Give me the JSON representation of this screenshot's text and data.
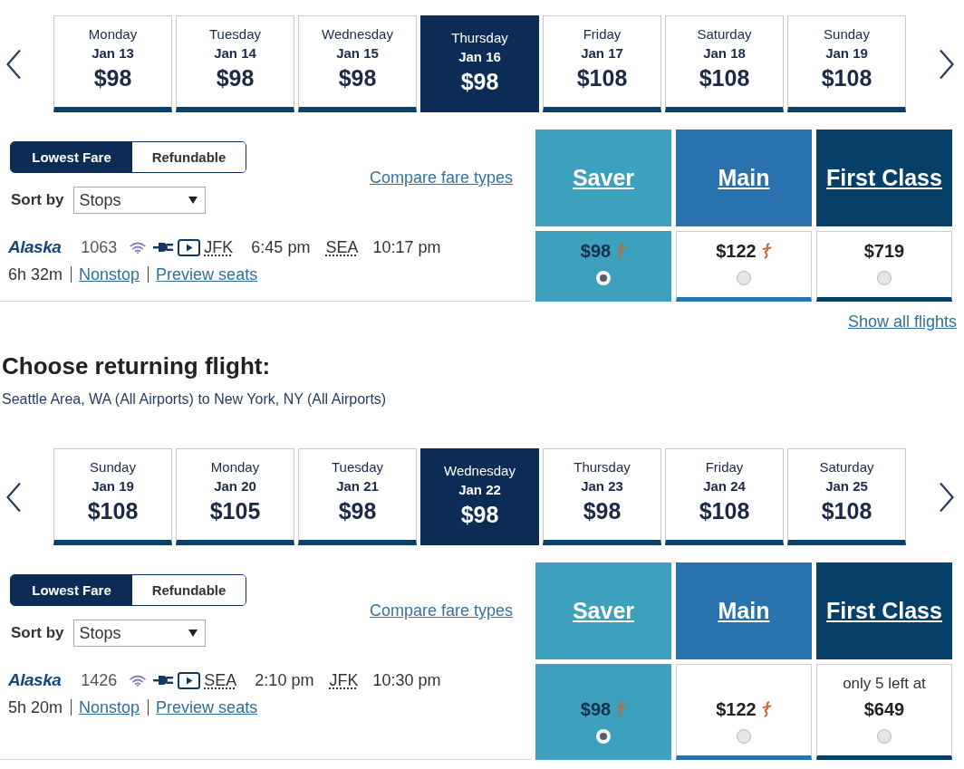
{
  "departing": {
    "dates": [
      {
        "weekday": "Monday",
        "date": "Jan 13",
        "price": "$98",
        "selected": false
      },
      {
        "weekday": "Tuesday",
        "date": "Jan 14",
        "price": "$98",
        "selected": false
      },
      {
        "weekday": "Wednesday",
        "date": "Jan 15",
        "price": "$98",
        "selected": false
      },
      {
        "weekday": "Thursday",
        "date": "Jan 16",
        "price": "$98",
        "selected": true
      },
      {
        "weekday": "Friday",
        "date": "Jan 17",
        "price": "$108",
        "selected": false
      },
      {
        "weekday": "Saturday",
        "date": "Jan 18",
        "price": "$108",
        "selected": false
      },
      {
        "weekday": "Sunday",
        "date": "Jan 19",
        "price": "$108",
        "selected": false
      }
    ],
    "fare_filter": [
      {
        "label": "Lowest Fare",
        "selected": true
      },
      {
        "label": "Refundable",
        "selected": false
      }
    ],
    "sort": {
      "label": "Sort by",
      "value": "Stops"
    },
    "compare_link": "Compare fare types",
    "fare_columns": [
      {
        "name": "Saver",
        "color": "#3da0bd"
      },
      {
        "name": "Main",
        "color": "#2a72ad"
      },
      {
        "name": "First Class",
        "color": "#063f68"
      }
    ],
    "flights": [
      {
        "airline": "Alaska",
        "number": "1063",
        "origin": "JFK",
        "departs": "6:45 pm",
        "destination": "SEA",
        "arrives": "10:17 pm",
        "duration": "6h 32m",
        "stops_link": "Nonstop",
        "seats_link": "Preview seats",
        "fares": [
          {
            "price": "$98",
            "fare_icon": true,
            "selected": true
          },
          {
            "price": "$122",
            "fare_icon": true,
            "selected": false
          },
          {
            "price": "$719",
            "fare_icon": false,
            "selected": false
          }
        ]
      }
    ],
    "show_all_link": "Show all flights"
  },
  "returning": {
    "heading": "Choose returning flight:",
    "route": "Seattle Area, WA (All Airports) to New York, NY (All Airports)",
    "dates": [
      {
        "weekday": "Sunday",
        "date": "Jan 19",
        "price": "$108",
        "selected": false
      },
      {
        "weekday": "Monday",
        "date": "Jan 20",
        "price": "$105",
        "selected": false
      },
      {
        "weekday": "Tuesday",
        "date": "Jan 21",
        "price": "$98",
        "selected": false
      },
      {
        "weekday": "Wednesday",
        "date": "Jan 22",
        "price": "$98",
        "selected": true
      },
      {
        "weekday": "Thursday",
        "date": "Jan 23",
        "price": "$98",
        "selected": false
      },
      {
        "weekday": "Friday",
        "date": "Jan 24",
        "price": "$108",
        "selected": false
      },
      {
        "weekday": "Saturday",
        "date": "Jan 25",
        "price": "$108",
        "selected": false
      }
    ],
    "fare_filter": [
      {
        "label": "Lowest Fare",
        "selected": true
      },
      {
        "label": "Refundable",
        "selected": false
      }
    ],
    "sort": {
      "label": "Sort by",
      "value": "Stops"
    },
    "compare_link": "Compare fare types",
    "fare_columns": [
      {
        "name": "Saver",
        "color": "#3da0bd"
      },
      {
        "name": "Main",
        "color": "#2a72ad"
      },
      {
        "name": "First Class",
        "color": "#063f68"
      }
    ],
    "flights": [
      {
        "airline": "Alaska",
        "number": "1426",
        "origin": "SEA",
        "departs": "2:10 pm",
        "destination": "JFK",
        "arrives": "10:30 pm",
        "duration": "5h 20m",
        "stops_link": "Nonstop",
        "seats_link": "Preview seats",
        "fares": [
          {
            "price": "$98",
            "fare_icon": true,
            "selected": true
          },
          {
            "price": "$122",
            "fare_icon": true,
            "selected": false
          },
          {
            "note": "only 5 left at",
            "price": "$649",
            "fare_icon": false,
            "selected": false
          }
        ]
      }
    ]
  }
}
